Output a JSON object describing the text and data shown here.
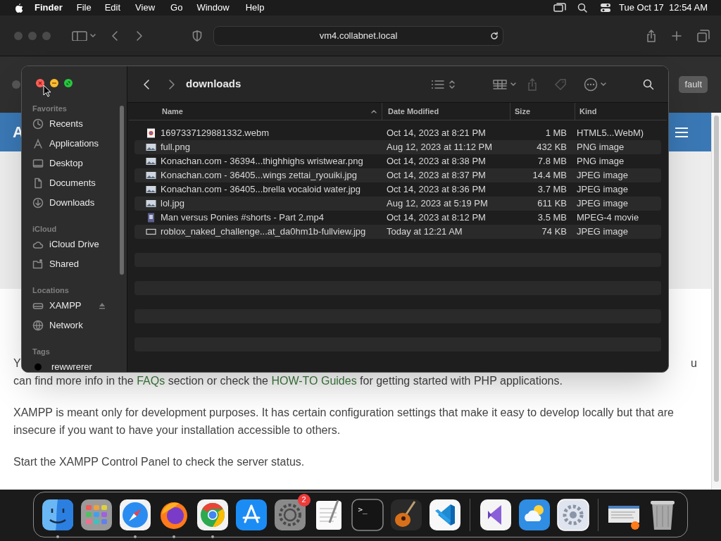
{
  "menu_bar": {
    "app": "Finder",
    "items": [
      "File",
      "Edit",
      "View",
      "Go",
      "Window",
      "Help"
    ],
    "clock": "Tue Oct 17  12:54 AM"
  },
  "browser": {
    "address": "vm4.collabnet.local"
  },
  "web_page": {
    "button_fragment": "fault",
    "header_letter": "A",
    "line_start": "Y",
    "line_end": "u",
    "paragraphs": [
      [
        {
          "text": "can find more info in the ",
          "link": false
        },
        {
          "text": "FAQs",
          "link": true
        },
        {
          "text": " section or check the ",
          "link": false
        },
        {
          "text": "HOW-TO Guides",
          "link": true
        },
        {
          "text": " for getting started with PHP applications.",
          "link": false
        }
      ],
      [
        {
          "text": "XAMPP is meant only for development purposes. It has certain configuration settings that make it easy to develop locally but that are insecure if you want to have your installation accessible to others.",
          "link": false
        }
      ],
      [
        {
          "text": "Start the XAMPP Control Panel to check the server status.",
          "link": false
        }
      ]
    ]
  },
  "finder": {
    "title": "downloads",
    "sidebar": [
      {
        "heading": "Favorites",
        "items": [
          {
            "label": "Recents"
          },
          {
            "label": "Applications"
          },
          {
            "label": "Desktop"
          },
          {
            "label": "Documents"
          },
          {
            "label": "Downloads"
          }
        ]
      },
      {
        "heading": "iCloud",
        "items": [
          {
            "label": "iCloud Drive"
          },
          {
            "label": "Shared"
          }
        ]
      },
      {
        "heading": "Locations",
        "items": [
          {
            "label": "XAMPP",
            "eject": true
          },
          {
            "label": "Network",
            "eject": false
          }
        ]
      },
      {
        "heading": "Tags",
        "items": [
          {
            "label": "rewwrerer",
            "color": "#000000"
          }
        ]
      }
    ],
    "columns": [
      {
        "label": "Name",
        "sorted": true
      },
      {
        "label": "Date Modified",
        "sorted": false
      },
      {
        "label": "Size",
        "sorted": false
      },
      {
        "label": "Kind",
        "sorted": false
      }
    ],
    "rows": [
      {
        "name": "1697337129881332.webm",
        "date": "Oct 14, 2023 at 8:21 PM",
        "size": "1 MB",
        "kind_text": "HTML5...WebM)",
        "kind": "web"
      },
      {
        "name": "full.png",
        "date": "Aug 12, 2023 at 11:12 PM",
        "size": "432 KB",
        "kind_text": "PNG image",
        "kind": "image"
      },
      {
        "name": "Konachan.com - 36394...thighhighs wristwear.png",
        "date": "Oct 14, 2023 at 8:38 PM",
        "size": "7.8 MB",
        "kind_text": "PNG image",
        "kind": "image"
      },
      {
        "name": "Konachan.com - 36405...wings zettai_ryouiki.jpg",
        "date": "Oct 14, 2023 at 8:37 PM",
        "size": "14.4 MB",
        "kind_text": "JPEG image",
        "kind": "image"
      },
      {
        "name": "Konachan.com - 36405...brella vocaloid water.jpg",
        "date": "Oct 14, 2023 at 8:36 PM",
        "size": "3.7 MB",
        "kind_text": "JPEG image",
        "kind": "image"
      },
      {
        "name": "lol.jpg",
        "date": "Aug 12, 2023 at 5:19 PM",
        "size": "611 KB",
        "kind_text": "JPEG image",
        "kind": "image"
      },
      {
        "name": "Man versus Ponies #shorts - Part 2.mp4",
        "date": "Oct 14, 2023 at 8:12 PM",
        "size": "3.5 MB",
        "kind_text": "MPEG-4 movie",
        "kind": "video"
      },
      {
        "name": "roblox_naked_challenge...at_da0hm1b-fullview.jpg",
        "date": "Today at 12:21 AM",
        "size": "74 KB",
        "kind_text": "JPEG image",
        "kind": "blank"
      }
    ]
  },
  "dock": [
    {
      "kind": "finder",
      "running": true
    },
    {
      "kind": "launchpad",
      "running": false
    },
    {
      "kind": "safari",
      "running": true
    },
    {
      "kind": "firefox",
      "running": true
    },
    {
      "kind": "chrome",
      "running": true
    },
    {
      "kind": "appstore",
      "running": false
    },
    {
      "kind": "settings",
      "running": false,
      "badge": "2"
    },
    {
      "kind": "textedit",
      "running": false
    },
    {
      "kind": "terminal",
      "running": false,
      "label": ">_"
    },
    {
      "kind": "guitar",
      "running": false
    },
    {
      "kind": "vscode",
      "running": false
    },
    {
      "kind": "divider"
    },
    {
      "kind": "vstudio",
      "running": false
    },
    {
      "kind": "weather",
      "running": false
    },
    {
      "kind": "gear",
      "running": false
    },
    {
      "kind": "divider"
    },
    {
      "kind": "window",
      "running": false
    },
    {
      "kind": "trash",
      "running": false
    }
  ]
}
